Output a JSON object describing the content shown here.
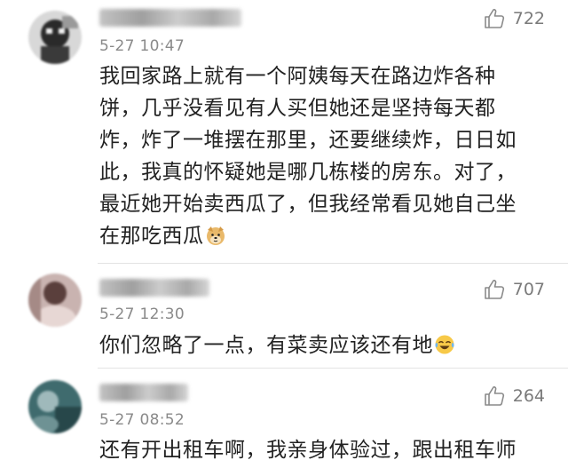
{
  "comments": [
    {
      "time": "5-27 10:47",
      "likes": "722",
      "lines": [
        "我回家路上就有一个阿姨每天在路边炸各种",
        "饼，几乎没看见有人买但她还是坚持每天都",
        "炸，炸了一堆摆在那里，还要继续炸，日日如",
        "此，我真的怀疑她是哪几栋楼的房东。对了，",
        "最近她开始卖西瓜了，但我经常看见她自己坐",
        "在那吃西瓜"
      ],
      "emoji": "doge-emoji"
    },
    {
      "time": "5-27 12:30",
      "likes": "707",
      "lines": [
        "你们忽略了一点，有菜卖应该还有地"
      ],
      "emoji": "laugh-cry-emoji"
    },
    {
      "time": "5-27 08:52",
      "likes": "264",
      "lines": [
        "还有开出租车啊，我亲身体验过，跟出租车师"
      ]
    }
  ],
  "colors": {
    "text": "#222222",
    "meta": "#8a8a8a",
    "divider": "#e3e3e3"
  }
}
